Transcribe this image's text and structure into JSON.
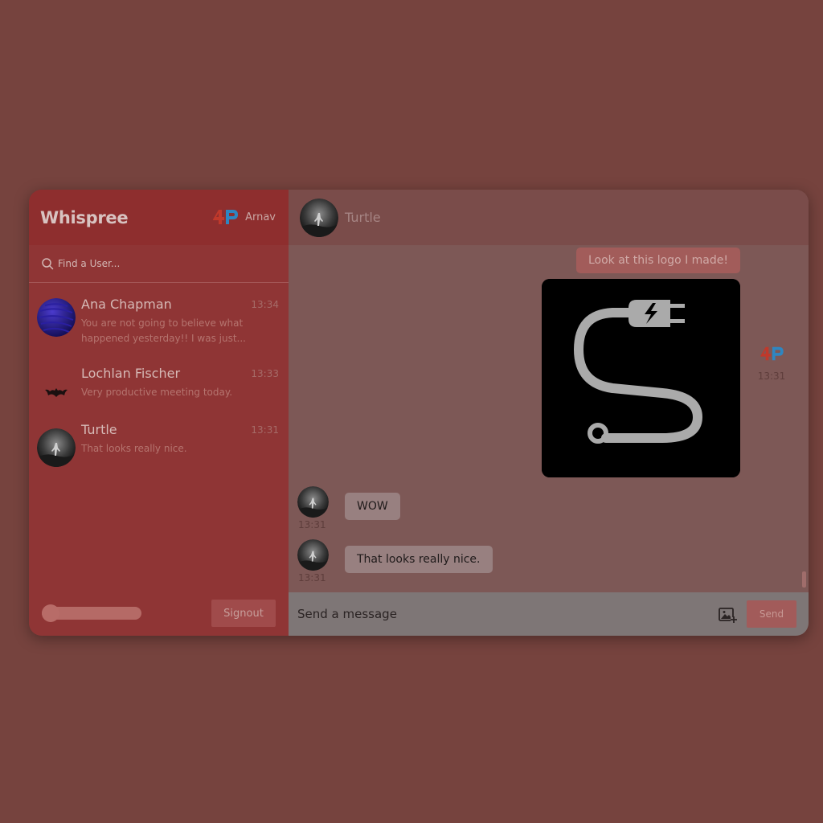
{
  "app": {
    "brand": "Whispree"
  },
  "current_user": {
    "initials": "AP",
    "name": "Arnav"
  },
  "search": {
    "placeholder": "Find a User..."
  },
  "conversations": [
    {
      "name": "Ana Chapman",
      "time": "13:34",
      "preview": "You are not going to believe what happened yesterday!! I was just...",
      "avatar": "blue-planet-avatar"
    },
    {
      "name": "Lochlan Fischer",
      "time": "13:33",
      "preview": "Very productive meeting today.",
      "avatar": "bat-avatar"
    },
    {
      "name": "Turtle",
      "time": "13:31",
      "preview": "That looks really nice.",
      "avatar": "dark-figure-avatar"
    }
  ],
  "footer": {
    "signout_label": "Signout",
    "theme_toggle_value": 0
  },
  "chat": {
    "title": "Turtle",
    "messages": [
      {
        "direction": "outgoing",
        "text": "Look at this logo I made!"
      },
      {
        "direction": "outgoing",
        "type": "image",
        "image": "plug-cable-logo",
        "sender_initials": "AP",
        "time": "13:31"
      },
      {
        "direction": "incoming",
        "text": "WOW",
        "time": "13:31"
      },
      {
        "direction": "incoming",
        "text": "That looks really nice.",
        "time": "13:31"
      }
    ]
  },
  "composer": {
    "placeholder": "Send a message",
    "send_label": "Send",
    "attach_icon": "image-plus-icon"
  },
  "colors": {
    "background": "#76433e",
    "sidebar": "#8f3535",
    "sidebar_header": "#8e2e2e",
    "chat_bg": "#7d5856",
    "outgoing_bubble": "#a25c5a",
    "incoming_bubble": "#988080",
    "accent_red": "#c0392b",
    "accent_blue": "#2e86c1"
  }
}
